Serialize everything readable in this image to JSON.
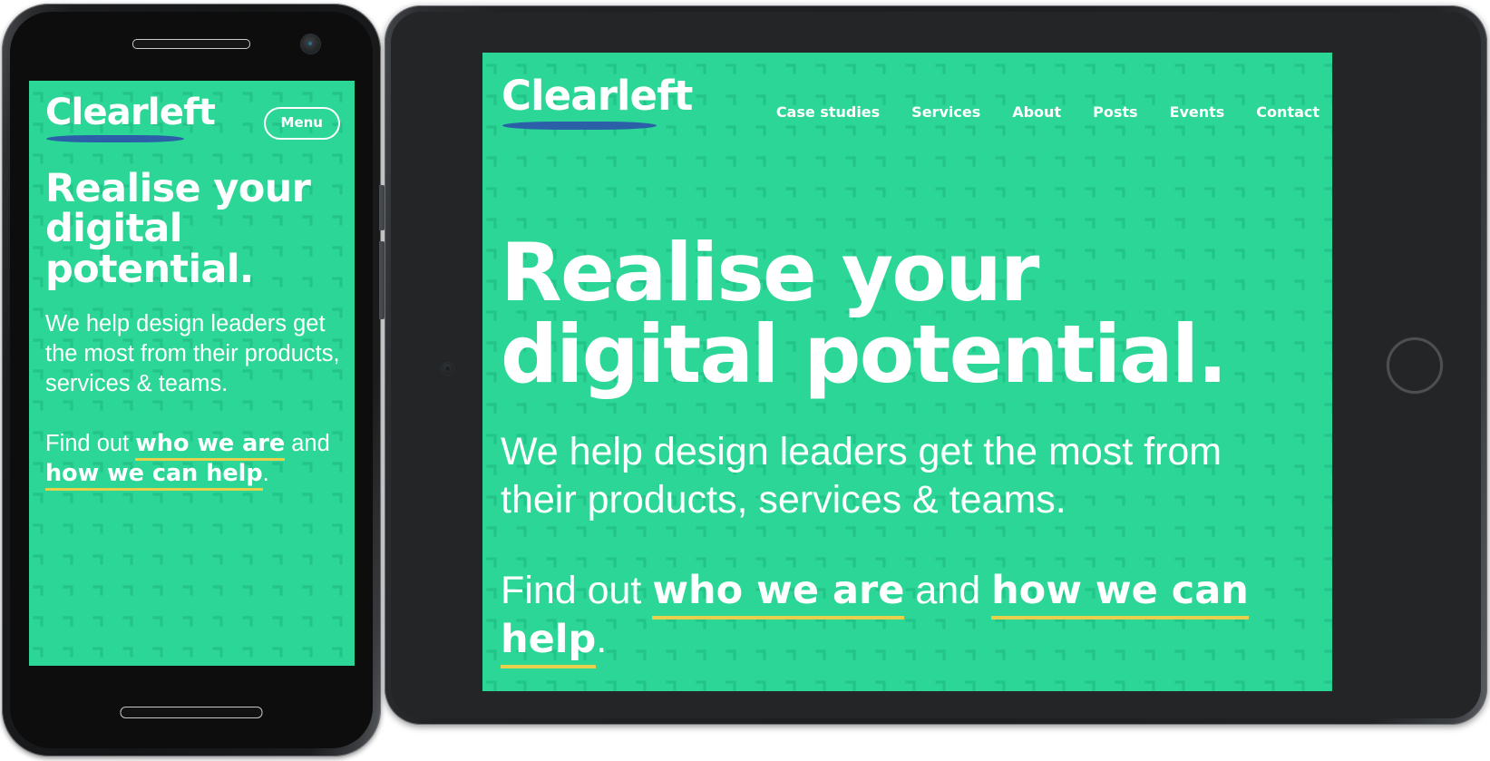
{
  "colors": {
    "brand_green": "#2bd696",
    "pattern": "#23c489",
    "logo_stroke_blue": "#2b5fa8",
    "link_underline_yellow": "#e8d14a",
    "text_white": "#ffffff",
    "device_body": "#1c1e20"
  },
  "brand": {
    "logo_text": "Clearleft"
  },
  "phone": {
    "device_name": "smartphone-device",
    "menu_button_label": "Menu",
    "headline": "Realise your digital potential.",
    "paragraph": "We help design leaders get the most from their products, services & teams.",
    "cta": {
      "prefix": "Find out ",
      "link1": "who we are",
      "middle": " and ",
      "link2": "how we can help",
      "suffix": "."
    }
  },
  "tablet": {
    "device_name": "tablet-device",
    "nav_items": [
      {
        "label": "Case studies"
      },
      {
        "label": "Services"
      },
      {
        "label": "About"
      },
      {
        "label": "Posts"
      },
      {
        "label": "Events"
      },
      {
        "label": "Contact"
      }
    ],
    "headline": "Realise your digital potential.",
    "paragraph": "We help design leaders get the most from their products, services & teams.",
    "cta": {
      "prefix": "Find out ",
      "link1": "who we are",
      "middle": " and ",
      "link2": "how we can help",
      "suffix": "."
    }
  }
}
